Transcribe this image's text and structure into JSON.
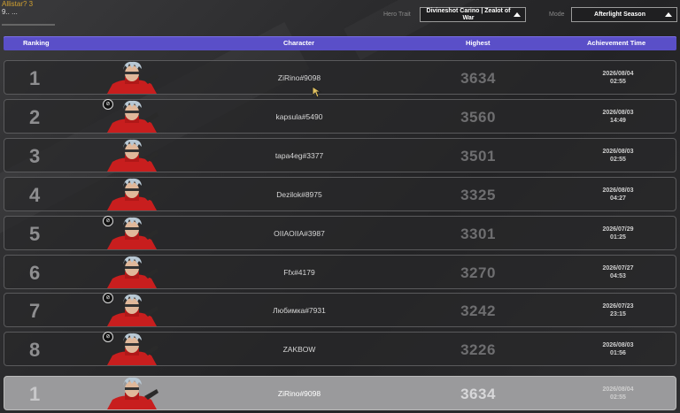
{
  "overlay": {
    "line1": "Allistar? 3",
    "line2": "9.. ..."
  },
  "filters": {
    "hero_trait_label": "Hero Trait",
    "hero_trait_value": "Divineshot Carino | Zealot of War",
    "mode_label": "Mode",
    "mode_value": "Afterlight Season"
  },
  "header": {
    "ranking": "Ranking",
    "character": "Character",
    "highest": "Highest",
    "time": "Achievement Time"
  },
  "rows": [
    {
      "rank": "1",
      "name": "ZiRino#9098",
      "score": "3634",
      "date": "2026/08/04",
      "clock": "02:55",
      "hidden": false
    },
    {
      "rank": "2",
      "name": "kapsula#5490",
      "score": "3560",
      "date": "2026/08/03",
      "clock": "14:49",
      "hidden": true
    },
    {
      "rank": "3",
      "name": "tapa4eg#3377",
      "score": "3501",
      "date": "2026/08/03",
      "clock": "02:55",
      "hidden": false
    },
    {
      "rank": "4",
      "name": "Dezilok#8975",
      "score": "3325",
      "date": "2026/08/03",
      "clock": "04:27",
      "hidden": false
    },
    {
      "rank": "5",
      "name": "OIIAOIIA#3987",
      "score": "3301",
      "date": "2026/07/29",
      "clock": "01:25",
      "hidden": true
    },
    {
      "rank": "6",
      "name": "Ffx#4179",
      "score": "3270",
      "date": "2026/07/27",
      "clock": "04:53",
      "hidden": false
    },
    {
      "rank": "7",
      "name": "Любимка#7931",
      "score": "3242",
      "date": "2026/07/23",
      "clock": "23:15",
      "hidden": true
    },
    {
      "rank": "8",
      "name": "ZAKBOW",
      "score": "3226",
      "date": "2026/08/03",
      "clock": "01:56",
      "hidden": true
    }
  ],
  "my_row": {
    "rank": "1",
    "name": "ZiRino#9098",
    "score": "3634",
    "date": "2026/08/04",
    "clock": "02:55"
  }
}
